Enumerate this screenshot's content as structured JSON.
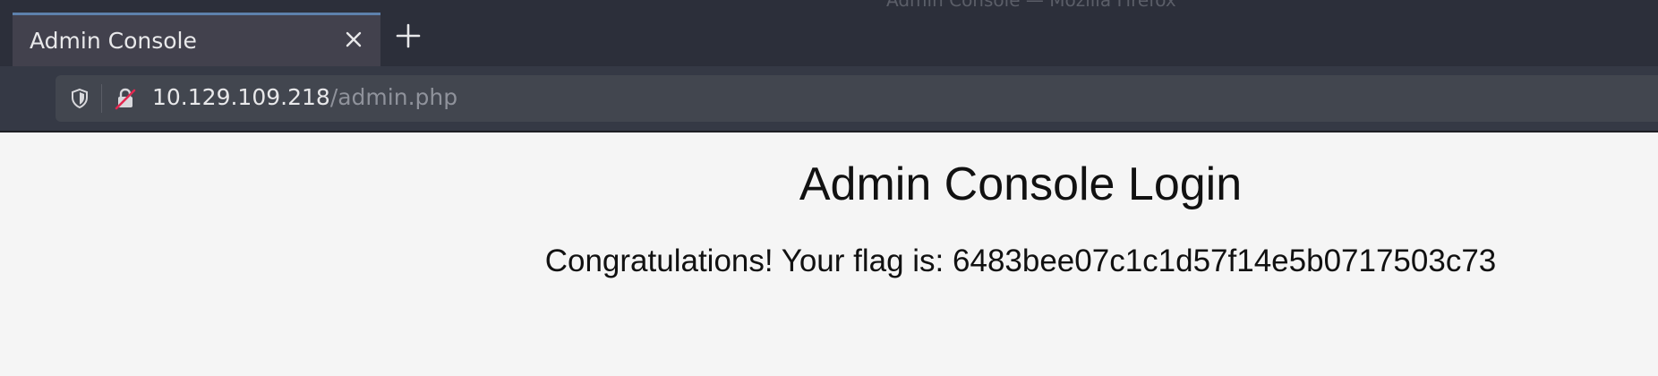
{
  "window": {
    "title": "Admin Console — Mozilla Firefox"
  },
  "tab": {
    "title": "Admin Console",
    "close_icon": "close-icon",
    "new_tab_icon": "plus-icon"
  },
  "urlbar": {
    "host": "10.129.109.218",
    "path": "/admin.php",
    "security_icons": [
      "shield-icon",
      "insecure-lock-icon"
    ]
  },
  "page": {
    "title": "Admin Console Login",
    "message": "Congratulations! Your flag is: 6483bee07c1c1d57f14e5b0717503c73"
  },
  "colors": {
    "chrome_bg": "#2c2f3a",
    "tab_active_bg": "#42414d",
    "tab_accent": "#5e81ac",
    "urlbar_bg": "#42464f",
    "page_bg": "#f5f5f5",
    "insecure_slash": "#e22850"
  }
}
